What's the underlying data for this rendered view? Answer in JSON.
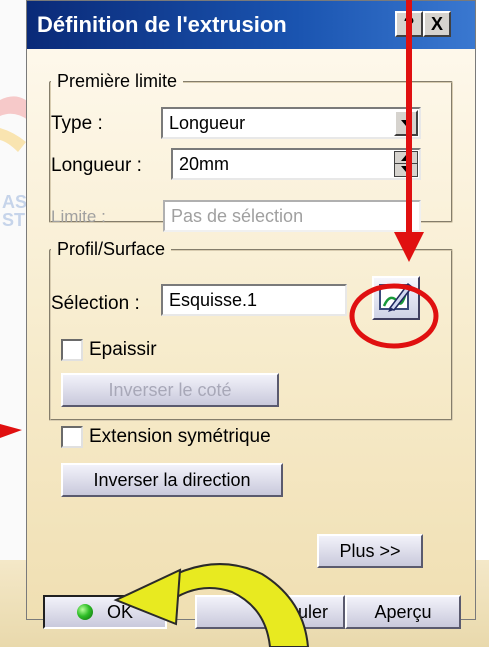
{
  "window": {
    "title": "Définition de l'extrusion",
    "help_label": "?",
    "close_label": "X"
  },
  "first_limit": {
    "legend": "Première limite",
    "type_label": "Type :",
    "type_value": "Longueur",
    "length_label": "Longueur :",
    "length_value": "20mm",
    "limit_label": "Limite :",
    "limit_value": "Pas de sélection"
  },
  "profile": {
    "legend": "Profil/Surface",
    "selection_label": "Sélection :",
    "selection_value": "Esquisse.1",
    "thicken_label": "Epaissir",
    "reverse_side_label": "Inverser le coté"
  },
  "options": {
    "symmetric_label": "Extension symétrique",
    "reverse_direction_label": "Inverser la direction",
    "more_label": "Plus >>"
  },
  "footer": {
    "ok_label": "OK",
    "cancel_label": "nuler",
    "preview_label": "Aperçu"
  },
  "colors": {
    "title_bar": "#0a2a78",
    "annotation_red": "#e01010",
    "arrow_yellow": "#e8ea20"
  }
}
